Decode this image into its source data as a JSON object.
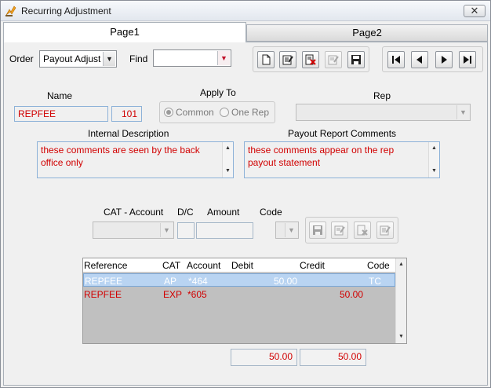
{
  "window": {
    "title": "Recurring Adjustment",
    "close_glyph": "✕"
  },
  "tabs": [
    {
      "label": "Page1"
    },
    {
      "label": "Page2"
    }
  ],
  "toolbar": {
    "order_label": "Order",
    "order_value": "Payout Adjust",
    "find_label": "Find",
    "find_value": "",
    "record_buttons": [
      "new-document-icon",
      "edit-document-icon",
      "delete-document-icon",
      "disabled-edit-icon",
      "save-icon"
    ],
    "nav_buttons": [
      "first-record-icon",
      "previous-record-icon",
      "next-record-icon",
      "last-record-icon"
    ]
  },
  "form": {
    "name_label": "Name",
    "name_value": "REPFEE",
    "name_number": "101",
    "apply_to_label": "Apply To",
    "apply_options": [
      {
        "label": "Common",
        "checked": true
      },
      {
        "label": "One Rep",
        "checked": false
      }
    ],
    "rep_label": "Rep",
    "rep_value": "",
    "internal_desc_label": "Internal Description",
    "internal_desc_value": "these comments are seen by the back office only",
    "payout_comments_label": "Payout Report Comments",
    "payout_comments_value": "these comments appear on the rep payout statement"
  },
  "entry": {
    "cat_account_label": "CAT - Account",
    "dc_label": "D/C",
    "amount_label": "Amount",
    "code_label": "Code",
    "buttons": [
      "save-icon",
      "edit-icon",
      "delete-icon",
      "edit-alt-icon"
    ]
  },
  "grid": {
    "columns": [
      "Reference",
      "CAT",
      "Account",
      "Debit",
      "Credit",
      "Code"
    ],
    "rows": [
      {
        "reference": "REPFEE",
        "cat": "AP",
        "account": "*464",
        "debit": "50.00",
        "credit": "",
        "code": "TC",
        "selected": true
      },
      {
        "reference": "REPFEE",
        "cat": "EXP",
        "account": "*605",
        "debit": "",
        "credit": "50.00",
        "code": "",
        "selected": false
      }
    ]
  },
  "totals": {
    "debit": "50.00",
    "credit": "50.00"
  },
  "colors": {
    "value_text": "#d10000",
    "selected_row": "#b9d4f2",
    "field_border": "#8db2d8"
  }
}
